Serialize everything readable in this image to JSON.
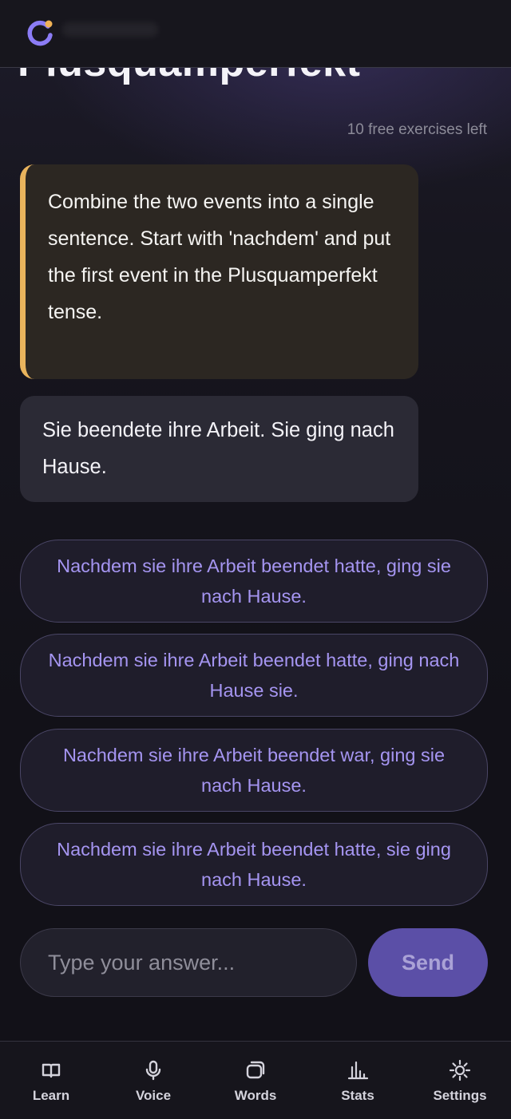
{
  "header": {
    "title": "Plusquamperfekt",
    "logo_icon": "ring-logo-icon",
    "accent_color": "#8b7cf6",
    "dot_color": "#f0b256"
  },
  "session": {
    "free_exercises_left": "10 free exercises left"
  },
  "exercise": {
    "instruction": "Combine the two events into a single sentence. Start with 'nachdem' and put the first event in the Plusquamperfekt tense.",
    "source_sentence": "Sie beendete ihre Arbeit. Sie ging nach Hause.",
    "options": [
      "Nachdem sie ihre Arbeit beendet hatte, ging sie nach Hause.",
      "Nachdem sie ihre Arbeit beendet hatte, ging nach Hause sie.",
      "Nachdem sie ihre Arbeit beendet war, ging sie nach Hause.",
      "Nachdem sie ihre Arbeit beendet hatte, sie ging nach Hause."
    ]
  },
  "answer_box": {
    "value": "",
    "placeholder": "Type your answer...",
    "send_label": "Send"
  },
  "tabbar": {
    "items": [
      {
        "label": "Learn",
        "icon": "book-icon"
      },
      {
        "label": "Voice",
        "icon": "microphone-icon"
      },
      {
        "label": "Words",
        "icon": "cards-icon"
      },
      {
        "label": "Stats",
        "icon": "bar-chart-icon"
      },
      {
        "label": "Settings",
        "icon": "sun-gear-icon"
      }
    ]
  }
}
